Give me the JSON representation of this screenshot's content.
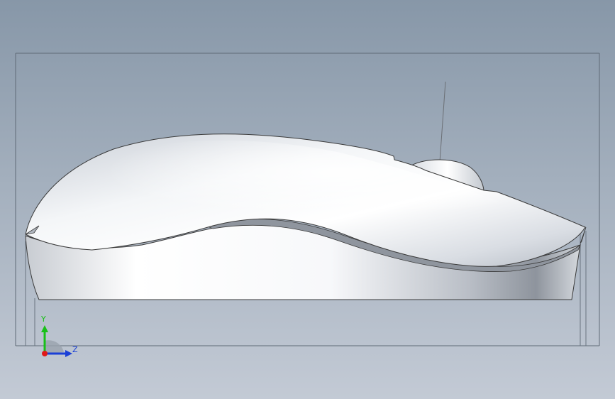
{
  "scene": {
    "background_top": "#8797a8",
    "background_bottom": "#c3cad5",
    "edge_color": "#3a3a3a",
    "frame_color": "#5f6a77"
  },
  "triad": {
    "y_label": "Y",
    "z_label": "Z",
    "y_color": "#18c018",
    "z_color": "#1a3fd6",
    "x_color": "#e01818"
  }
}
